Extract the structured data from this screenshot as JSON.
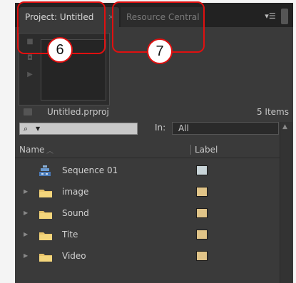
{
  "tabs": {
    "project": {
      "label": "Project: Untitled",
      "close": "×"
    },
    "resource": {
      "label": "Resource Central"
    },
    "menu_glyph": "▾☰"
  },
  "project": {
    "filename": "Untitled.prproj",
    "item_count": "5 Items"
  },
  "search": {
    "in_label": "In:",
    "in_value": "All"
  },
  "columns": {
    "name": "Name",
    "label": "Label"
  },
  "items": [
    {
      "name": "Sequence 01",
      "type": "sequence",
      "label_color": "#c8d4d8"
    },
    {
      "name": "image",
      "type": "bin",
      "label_color": "#e0c488"
    },
    {
      "name": "Sound",
      "type": "bin",
      "label_color": "#e0c488"
    },
    {
      "name": "Tite",
      "type": "bin",
      "label_color": "#e0c488"
    },
    {
      "name": "Video",
      "type": "bin",
      "label_color": "#e0c488"
    }
  ],
  "callouts": {
    "first": "6",
    "second": "7"
  },
  "colors": {
    "panel_bg": "#3a3a3a",
    "folder": "#e8c46a",
    "callout": "#e01010"
  }
}
